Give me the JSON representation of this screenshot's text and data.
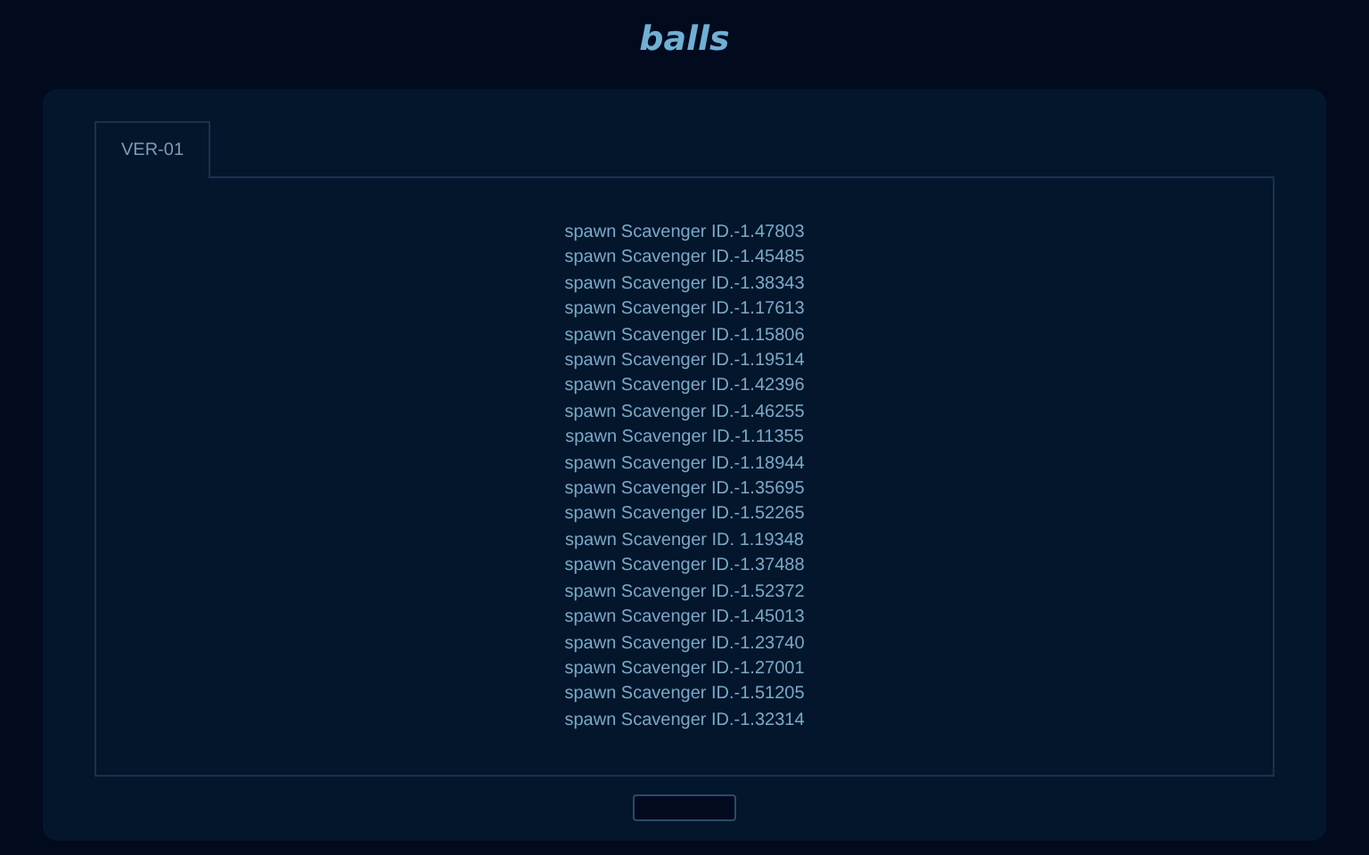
{
  "title": "balls",
  "tabs": [
    {
      "label": "VER-01",
      "selected": true
    }
  ],
  "log_lines": [
    "spawn Scavenger ID.-1.47803",
    "spawn Scavenger ID.-1.45485",
    "spawn Scavenger ID.-1.38343",
    "spawn Scavenger ID.-1.17613",
    "spawn Scavenger ID.-1.15806",
    "spawn Scavenger ID.-1.19514",
    "spawn Scavenger ID.-1.42396",
    "spawn Scavenger ID.-1.46255",
    "spawn Scavenger ID.-1.11355",
    "spawn Scavenger ID.-1.18944",
    "spawn Scavenger ID.-1.35695",
    "spawn Scavenger ID.-1.52265",
    "spawn Scavenger ID. 1.19348",
    "spawn Scavenger ID.-1.37488",
    "spawn Scavenger ID.-1.52372",
    "spawn Scavenger ID.-1.45013",
    "spawn Scavenger ID.-1.23740",
    "spawn Scavenger ID.-1.27001",
    "spawn Scavenger ID.-1.51205",
    "spawn Scavenger ID.-1.32314"
  ]
}
